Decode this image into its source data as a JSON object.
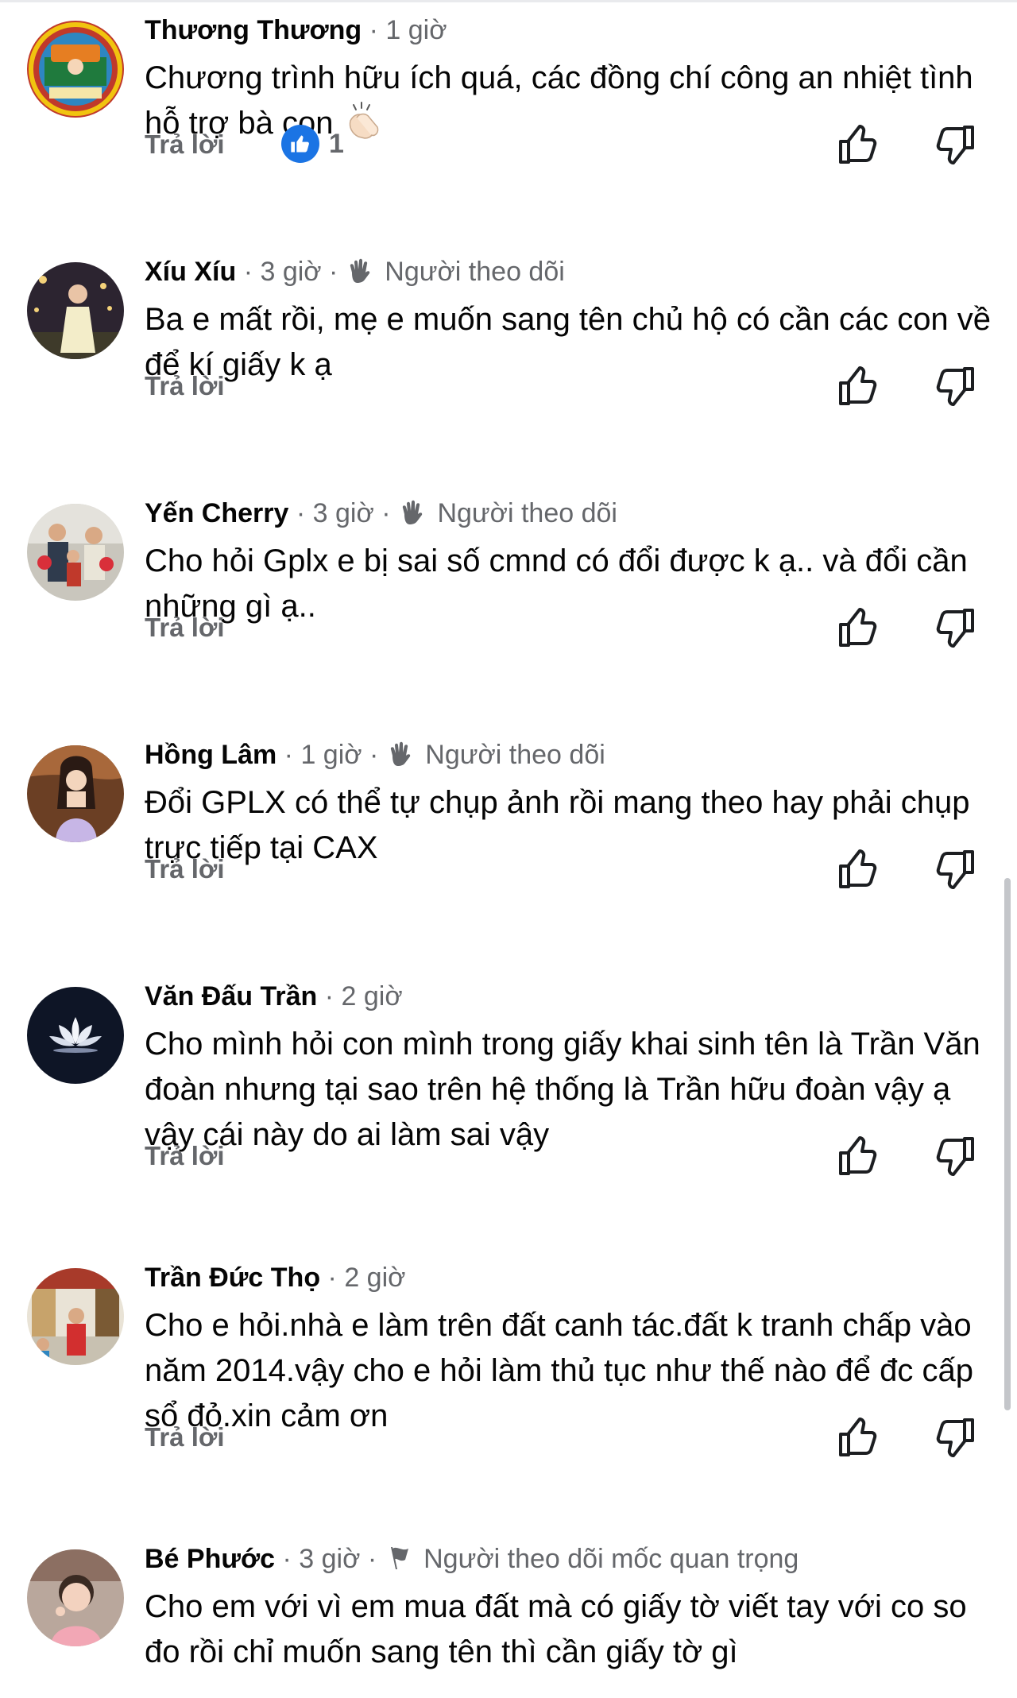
{
  "comments": [
    {
      "name": "Thương Thương",
      "sep": "·",
      "time": "1 giờ",
      "badge": "",
      "text": "Chương trình hữu ích quá, các đồng chí công an nhiệt tình hỗ trợ bà con",
      "emoji": "clapping-hands",
      "reply": "Trả lời",
      "reaction_count": "1",
      "avatar_color": "#c0392b"
    },
    {
      "name": "Xíu Xíu",
      "sep": "·",
      "time": "3 giờ",
      "badge": "Người theo dõi",
      "text": "Ba e mất rồi, mẹ e muốn sang tên chủ hộ có cần các con về để kí giấy k ạ",
      "reply": "Trả lời",
      "avatar_color": "#3a2f3d"
    },
    {
      "name": "Yến Cherry",
      "sep": "·",
      "time": "3 giờ",
      "badge": "Người theo dõi",
      "text": "Cho hỏi Gplx e bị sai số cmnd có đổi được k ạ.. và đổi cần những gì ạ..",
      "reply": "Trả lời",
      "avatar_color": "#b7b2a8"
    },
    {
      "name": "Hồng Lâm",
      "sep": "·",
      "time": "1 giờ",
      "badge": "Người theo dõi",
      "text": "Đổi GPLX có thể tự chụp ảnh rồi mang theo hay phải chụp trực tiếp tại CAX",
      "reply": "Trả lời",
      "avatar_color": "#8a5a3c"
    },
    {
      "name": "Văn Đấu Trần",
      "sep": "·",
      "time": "2 giờ",
      "badge": "",
      "text": "Cho mình hỏi con mình trong giấy khai sinh tên là Trần Văn đoàn nhưng tại sao trên hệ thống là Trần hữu đoàn vậy ạ vậy cái này do ai làm sai vậy",
      "reply": "Trả lời",
      "avatar_color": "#101828"
    },
    {
      "name": "Trần Đức Thọ",
      "sep": "·",
      "time": "2 giờ",
      "badge": "",
      "text": "Cho e hỏi.nhà e làm trên đất canh tác.đất k tranh chấp vào năm 2014.vậy cho e hỏi làm thủ tục như thế nào để đc cấp sổ đỏ.xin cảm ơn",
      "reply": "Trả lời",
      "avatar_color": "#a83a2a"
    },
    {
      "name": "Bé Phước",
      "sep": "·",
      "time": "3 giờ",
      "badge": "Người theo dõi mốc quan trọng",
      "text": "Cho em với vì em mua đất mà có giấy tờ viết tay với co so đo rồi chỉ muốn sang tên thì cần giấy tờ gì",
      "avatar_color": "#d88a7c"
    }
  ],
  "colors": {
    "text": "#050505",
    "secondary": "#65676b",
    "like_blue": "#1b74e4"
  },
  "icons": {
    "upvote": "thumb-up-outline-icon",
    "downvote": "thumb-down-outline-icon",
    "follower_badge": "waving-hand-icon",
    "milestone_badge": "flag-icon",
    "reaction": "like-reaction-icon"
  }
}
